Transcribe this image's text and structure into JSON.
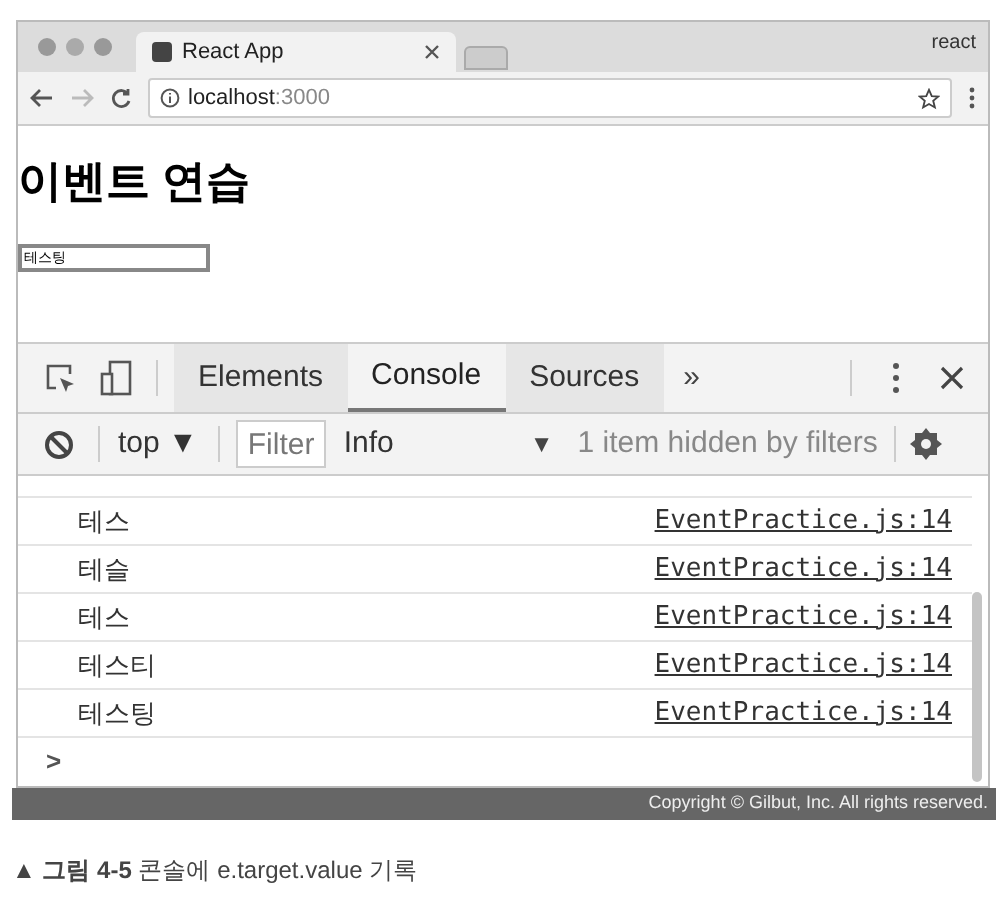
{
  "browser": {
    "tab_title": "React App",
    "profile": "react",
    "url_host": "localhost",
    "url_port": ":3000"
  },
  "page": {
    "heading": "이벤트 연습",
    "input_value": "테스팅"
  },
  "devtools": {
    "tabs": [
      {
        "label": "Elements",
        "selected": false
      },
      {
        "label": "Console",
        "selected": true
      },
      {
        "label": "Sources",
        "selected": false
      }
    ],
    "more": "»",
    "context": "top ▼",
    "filter": {
      "placeholder": "Filter"
    },
    "level": "Info",
    "level_caret": "▼",
    "hidden_note": "1 item hidden by filters",
    "logs": [
      {
        "message": "테스",
        "source": "EventPractice.js:14"
      },
      {
        "message": "테슬",
        "source": "EventPractice.js:14"
      },
      {
        "message": "테스",
        "source": "EventPractice.js:14"
      },
      {
        "message": "테스티",
        "source": "EventPractice.js:14"
      },
      {
        "message": "테스팅",
        "source": "EventPractice.js:14"
      }
    ],
    "prompt": ">"
  },
  "copyright": "Copyright © Gilbut, Inc. All rights reserved.",
  "caption": "▲ **그림 4-5** 콘솔에 e.target.value 기록"
}
